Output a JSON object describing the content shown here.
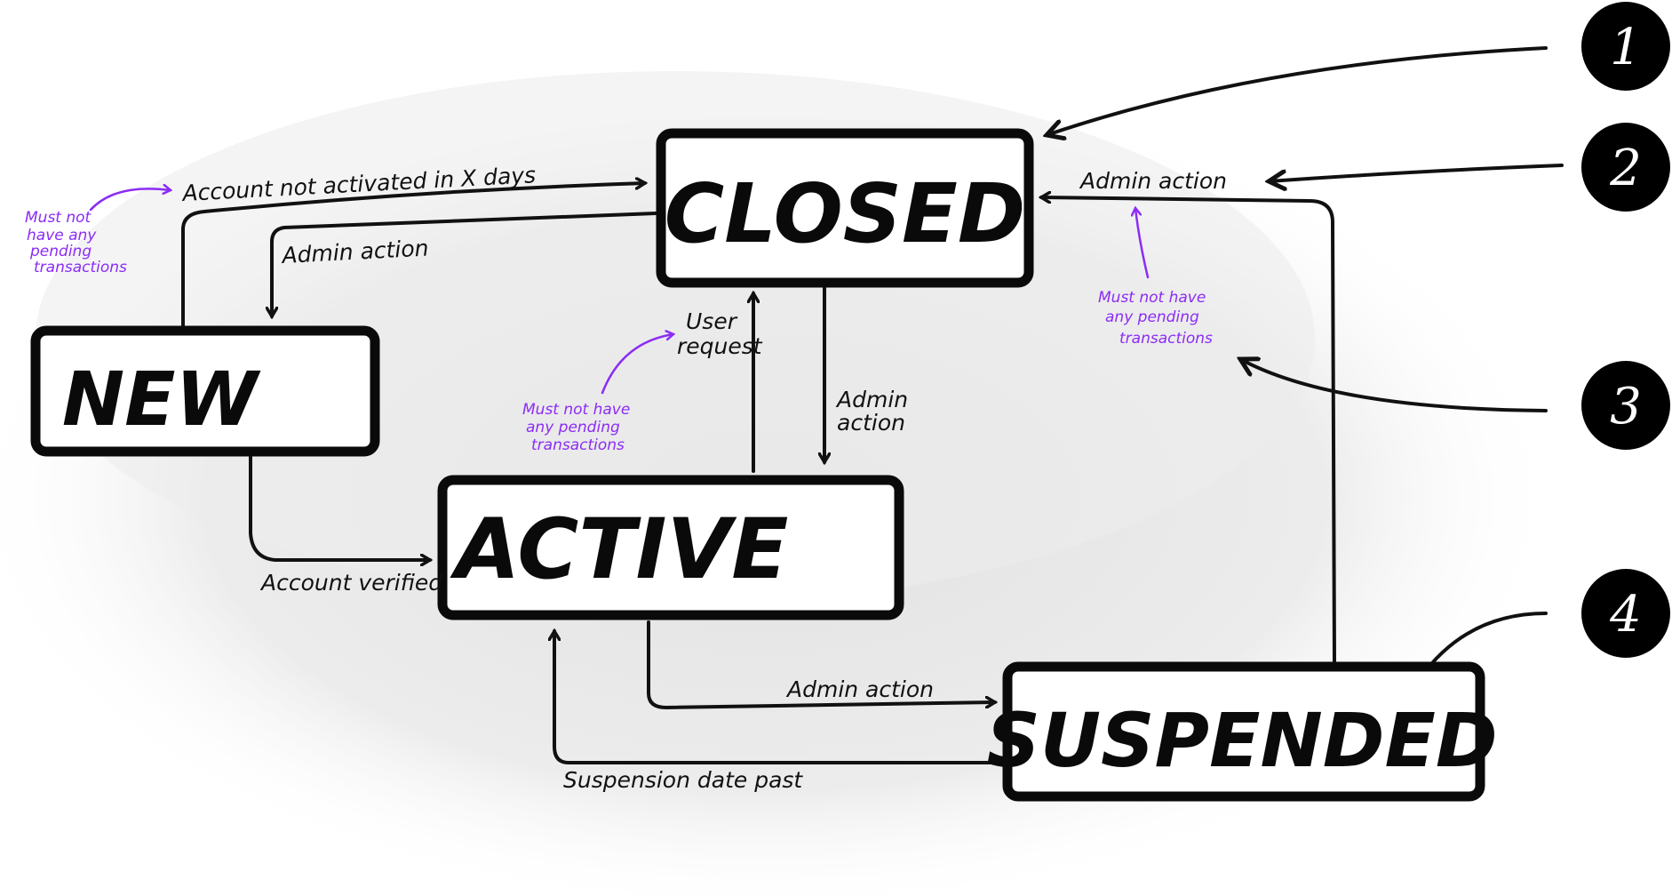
{
  "states": {
    "closed": "CLOSED",
    "new": "NEW",
    "active": "ACTIVE",
    "suspended": "SUSPENDED"
  },
  "transitions": {
    "new_to_closed": "Account not activated in X days",
    "closed_to_new": "Admin action",
    "new_to_active": "Account verified",
    "active_to_closed": [
      "User",
      "request"
    ],
    "closed_to_active": [
      "Admin",
      "action"
    ],
    "active_to_suspended": "Admin action",
    "suspended_to_active": "Suspension date past",
    "suspended_to_closed": "Admin action"
  },
  "notes": {
    "left": [
      "Must not",
      "have any",
      "pending",
      "transactions"
    ],
    "middle": [
      "Must not have",
      "any pending",
      "transactions"
    ],
    "right": [
      "Must not have",
      "any pending",
      "transactions"
    ]
  },
  "callouts": [
    "1",
    "2",
    "3",
    "4"
  ],
  "colors": {
    "ink": "#111111",
    "note": "#8b2cf5",
    "background_wash": "#e6e6e6"
  }
}
